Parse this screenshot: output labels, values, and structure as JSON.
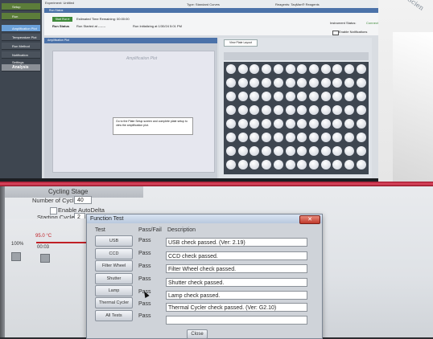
{
  "top_screen": {
    "sidebar": [
      {
        "label": "Setup"
      },
      {
        "label": "Run"
      },
      {
        "label": "Amplification Plot"
      },
      {
        "label": "Temperature Plot"
      },
      {
        "label": "Run Method"
      },
      {
        "label": "Notification Settings"
      },
      {
        "label": "Analysis"
      }
    ],
    "experiment": "Experiment: Untitled",
    "type": "Type: Standard Curves",
    "reagents": "Reagents: TaqMan® Reagents",
    "run_status_title": "Run Status",
    "start_run": "Start Run ▾",
    "estimated_time": "Estimated Time Remaining: 00:00:00",
    "run_status_label": "Run Status",
    "run_started": "Run Started at  -------",
    "run_initializing": "Run Initializing at 1/30/24 5:01 PM",
    "instrument_status": "Instrument Status:",
    "connected": "Connected",
    "enable_notifications": "Enable Notifications",
    "amp_panel_title": "Amplification Plot",
    "amp_plot_title": "Amplification Plot",
    "amp_note": "Go to the Plate Setup screen and complete plate setup to view the amplification plot.",
    "plate_tab": "View Plate Layout",
    "wall_text": "Scien"
  },
  "bottom_screen": {
    "cycling_stage": "Cycling Stage",
    "number_of_cycles_label": "Number of Cycles:",
    "number_of_cycles": "40",
    "enable_autodelta": "Enable AutoDelta",
    "starting_cycle_label": "Starting Cycle:",
    "starting_cycle": "2",
    "temperature": "95.0 °C",
    "percent": "100%",
    "time": "00:03",
    "dialog": {
      "title": "Function Test",
      "close_glyph": "✕",
      "col_test": "Test",
      "col_passfail": "Pass/Fail",
      "col_description": "Description",
      "rows": [
        {
          "test": "USB",
          "result": "Pass",
          "description": "USB check passed. (Ver: 2.19)"
        },
        {
          "test": "CCD",
          "result": "Pass",
          "description": "CCD check passed."
        },
        {
          "test": "Filter Wheel",
          "result": "Pass",
          "description": "Filter Wheel check passed."
        },
        {
          "test": "Shutter",
          "result": "Pass",
          "description": "Shutter check passed."
        },
        {
          "test": "Lamp",
          "result": "Pass",
          "description": "Lamp check passed."
        },
        {
          "test": "Thermal Cycler",
          "result": "Pass",
          "description": "Thermal Cycler check passed. (Ver: G2.10)"
        },
        {
          "test": "All Tests",
          "result": "Pass",
          "description": ""
        }
      ],
      "close_label": "Close"
    }
  },
  "colors": {
    "accent_red": "#c02026",
    "sidebar_green": "#5c7d3a",
    "panel_blue": "#4b72a9",
    "dialog_bg": "#cfd3d9"
  }
}
